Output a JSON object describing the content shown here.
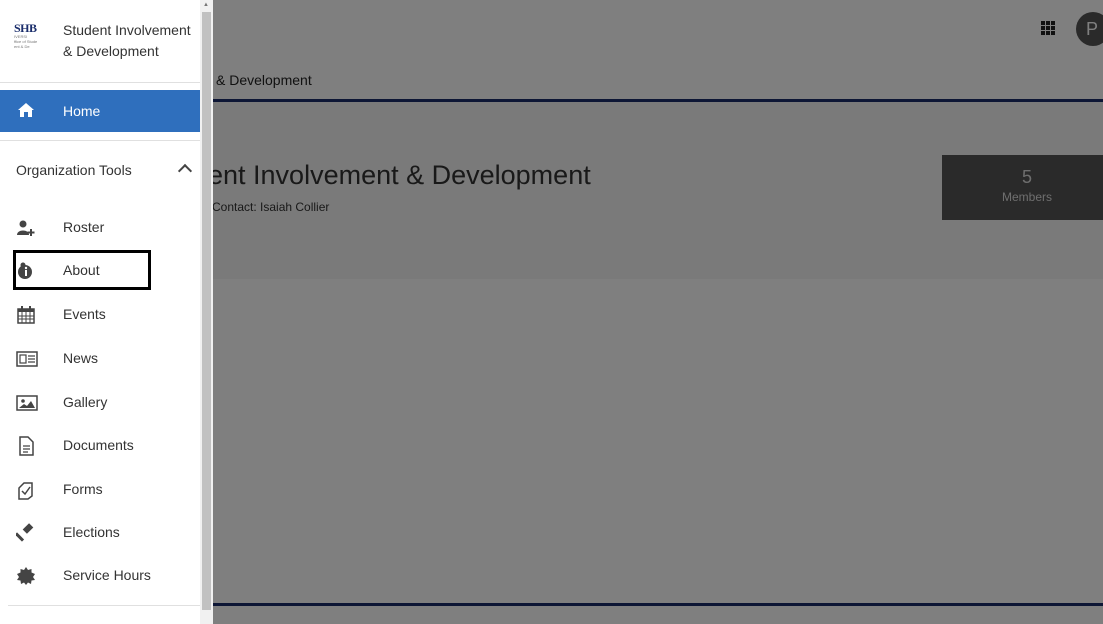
{
  "header": {
    "avatar_initial": "P"
  },
  "subnav": {
    "title": "& Development"
  },
  "hero": {
    "org_name": "ent Involvement & Development",
    "contact": "Contact: Isaiah Collier",
    "members_count": "5",
    "members_label": "Members"
  },
  "drawer": {
    "logo_main": "SHB",
    "logo_sub1": "IVERSI",
    "logo_sub2": "ffice of Stude",
    "logo_sub3": "ent & De",
    "title_line1": "Student Involvement",
    "title_line2": "& Development",
    "home_label": "Home",
    "section_label": "Organization Tools",
    "items": [
      {
        "label": "Roster",
        "icon": "add-user-icon"
      },
      {
        "label": "About",
        "icon": "info-icon"
      },
      {
        "label": "Events",
        "icon": "calendar-icon"
      },
      {
        "label": "News",
        "icon": "newspaper-icon"
      },
      {
        "label": "Gallery",
        "icon": "image-icon"
      },
      {
        "label": "Documents",
        "icon": "document-icon"
      },
      {
        "label": "Forms",
        "icon": "forms-icon"
      },
      {
        "label": "Elections",
        "icon": "gavel-icon"
      },
      {
        "label": "Service Hours",
        "icon": "badge-icon"
      }
    ]
  },
  "colors": {
    "accent": "#2f6fbd",
    "rule": "#1a2d6b",
    "overlay": "rgba(0,0,0,0.5)"
  }
}
